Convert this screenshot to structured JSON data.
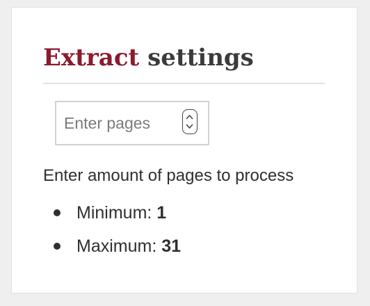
{
  "settings": {
    "title_accent": "Extract",
    "title_rest": "settings",
    "pages_input": {
      "value": "",
      "placeholder": "Enter pages"
    },
    "help_text": "Enter amount of pages to process",
    "limits": [
      {
        "label": "Minimum:",
        "value": "1"
      },
      {
        "label": "Maximum:",
        "value": "31"
      }
    ]
  },
  "colors": {
    "accent": "#8b1a2e",
    "text": "#2f2f2f",
    "background": "#efefef",
    "panel": "#ffffff"
  },
  "icons": {
    "stepper": "up-down-chevron-icon"
  }
}
